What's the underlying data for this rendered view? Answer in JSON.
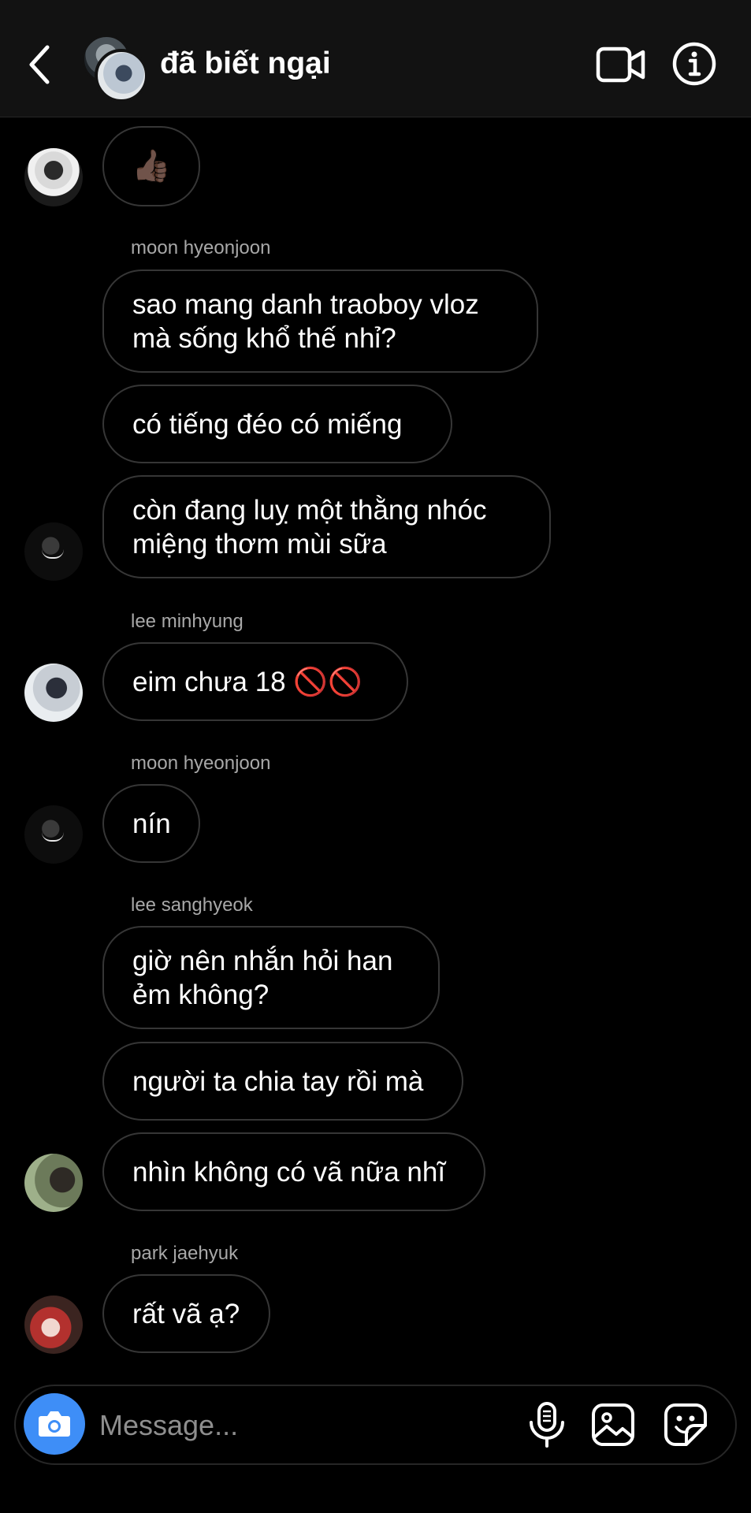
{
  "header": {
    "title": "đã biết ngại",
    "back_icon": "chevron-left-icon",
    "video_icon": "video-camera-icon",
    "info_icon": "info-icon"
  },
  "messages": {
    "m1": {
      "text": "👍🏿"
    },
    "g1": {
      "sender": "moon hyeonjoon"
    },
    "m2": {
      "text": "sao mang danh traoboy vloz\nmà sống khổ thế nhỉ?"
    },
    "m3": {
      "text": "có tiếng đéo có miếng"
    },
    "m4": {
      "text": "còn đang luỵ một thằng nhóc\nmiệng thơm mùi sữa"
    },
    "g2": {
      "sender": "lee minhyung"
    },
    "m5": {
      "text": "eim chưa 18 🚫🚫"
    },
    "g3": {
      "sender": "moon hyeonjoon"
    },
    "m6": {
      "text": "nín"
    },
    "g4": {
      "sender": "lee sanghyeok"
    },
    "m7": {
      "text": "giờ nên nhắn hỏi han\nẻm không?"
    },
    "m8": {
      "text": "người ta chia tay rồi mà"
    },
    "m9": {
      "text": "nhìn không có vã nữa nhĩ"
    },
    "g5": {
      "sender": "park jaehyuk"
    },
    "m10": {
      "text": "rất vã ạ?"
    }
  },
  "composer": {
    "placeholder": "Message...",
    "camera_color": "#3e8ef7",
    "icons": [
      "camera-icon",
      "microphone-icon",
      "gallery-icon",
      "sticker-icon"
    ]
  },
  "colors": {
    "background": "#000000",
    "header_bg": "#121212",
    "bubble_border": "#363636",
    "sender_name": "#a8a8a8"
  }
}
